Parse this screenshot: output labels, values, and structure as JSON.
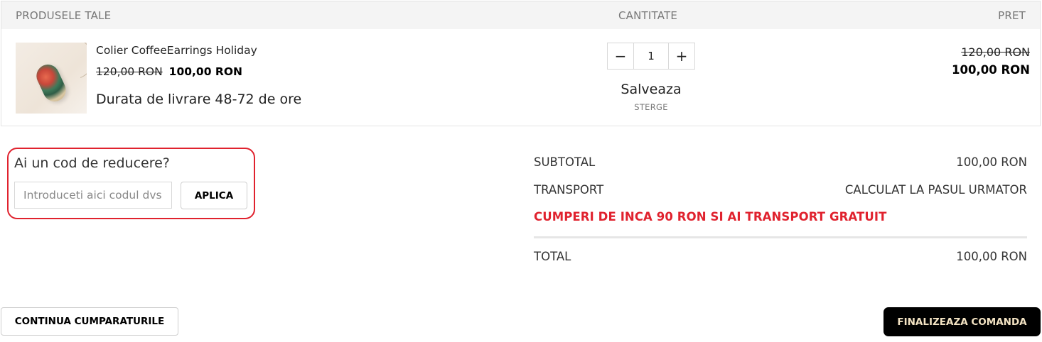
{
  "cart": {
    "headers": {
      "product": "PRODUSELE TALE",
      "quantity": "CANTITATE",
      "price": "PRET"
    },
    "item": {
      "name": "Colier CoffeeEarrings Holiday",
      "old_price": "120,00 RON",
      "new_price": "100,00 RON",
      "delivery": "Durata de livrare 48-72 de ore",
      "quantity": "1",
      "minus_label": "−",
      "plus_label": "+",
      "save_label": "Salveaza",
      "delete_label": "STERGE",
      "row_old_price": "120,00 RON",
      "row_new_price": "100,00 RON"
    }
  },
  "coupon": {
    "title": "Ai un cod de reducere?",
    "placeholder": "Introduceti aici codul dvs",
    "apply_label": "APLICA"
  },
  "summary": {
    "subtotal_label": "SUBTOTAL",
    "subtotal_value": "100,00 RON",
    "transport_label": "TRANSPORT",
    "transport_value": "CALCULAT LA PASUL URMATOR",
    "free_shipping_notice": "CUMPERI DE INCA 90 RON SI AI TRANSPORT GRATUIT",
    "total_label": "TOTAL",
    "total_value": "100,00 RON"
  },
  "actions": {
    "continue_label": "CONTINUA CUMPARATURILE",
    "finalize_label": "FINALIZEAZA COMANDA"
  },
  "colors": {
    "accent_red": "#e0222e",
    "finalize_bg": "#000000",
    "finalize_text": "#f3e3c3"
  }
}
